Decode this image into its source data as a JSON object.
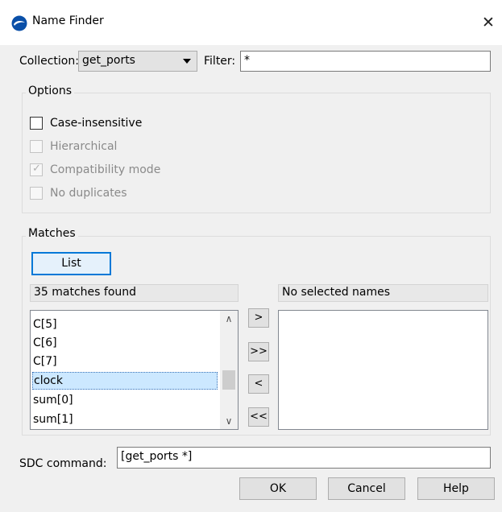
{
  "window": {
    "title": "Name Finder",
    "close_glyph": "✕"
  },
  "collection": {
    "label": "Collection:",
    "value": "get_ports"
  },
  "filter": {
    "label": "Filter:",
    "value": "*"
  },
  "options": {
    "title": "Options",
    "case_insensitive": {
      "label": "Case-insensitive",
      "checked": false,
      "enabled": true
    },
    "hierarchical": {
      "label": "Hierarchical",
      "checked": false,
      "enabled": false
    },
    "compatibility": {
      "label": "Compatibility mode",
      "checked": true,
      "enabled": false
    },
    "no_duplicates": {
      "label": "No duplicates",
      "checked": false,
      "enabled": false
    }
  },
  "matches": {
    "title": "Matches",
    "list_button": "List",
    "found_text": "35 matches found",
    "items": [
      "C[5]",
      "C[6]",
      "C[7]",
      "clock",
      "sum[0]",
      "sum[1]"
    ],
    "selected_item": "clock",
    "selected_header": "No selected names"
  },
  "transfer": {
    "add": ">",
    "add_all": ">>",
    "remove": "<",
    "remove_all": "<<"
  },
  "sdc": {
    "label": "SDC command:",
    "value": "[get_ports *]"
  },
  "buttons": {
    "ok": "OK",
    "cancel": "Cancel",
    "help": "Help"
  },
  "colors": {
    "accent": "#0078d7",
    "selection": "#cce8ff",
    "dialog_bg": "#f0f0f0"
  },
  "icons": {
    "app": "quartus-logo-icon",
    "close": "close-icon",
    "dropdown": "chevron-down-icon"
  }
}
